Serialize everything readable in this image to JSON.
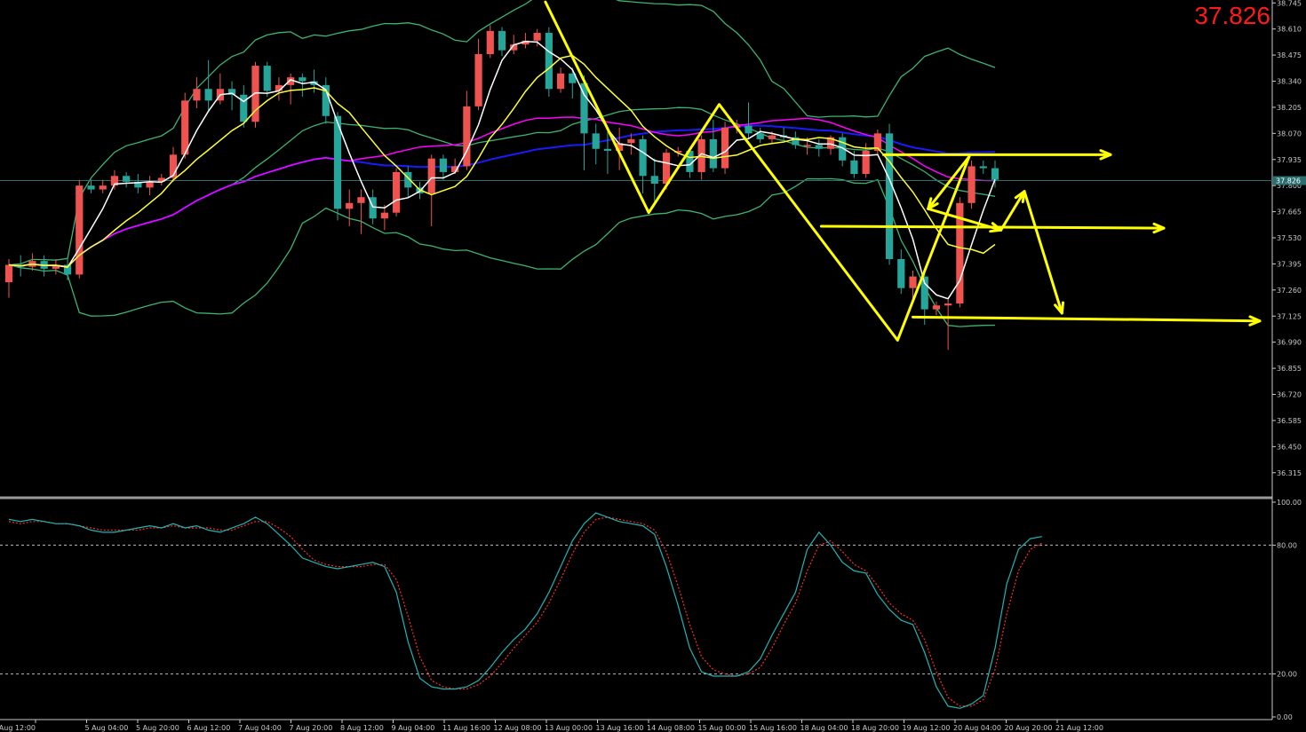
{
  "price_label": "37.826",
  "colors": {
    "background": "#000000",
    "bull": "#26a69a",
    "bear": "#ef5350",
    "bollinger": "#3cb371",
    "ma_fast": "#ffffff",
    "ma_mid": "#ffff33",
    "ma_slow_blue": "#1a1aff",
    "ma_magenta": "#ff00ff",
    "annotation": "#ffff00",
    "stoch_main": "#1fb5b5",
    "stoch_signal": "#ff2a2a",
    "price_line": "#2a6f6f"
  },
  "chart_data": [
    {
      "type": "candlestick",
      "price_axis": {
        "ticks": [
          "38.745",
          "38.610",
          "38.475",
          "38.340",
          "38.205",
          "38.070",
          "37.935",
          "37.800",
          "37.665",
          "37.530",
          "37.395",
          "37.260",
          "37.125",
          "36.990",
          "36.855",
          "36.720",
          "36.585",
          "36.450",
          "36.315"
        ],
        "ylim": [
          36.19,
          38.76
        ]
      },
      "time_axis": {
        "labels": [
          "4 Aug 12:00",
          "5 Aug 04:00",
          "5 Aug 20:00",
          "6 Aug 12:00",
          "7 Aug 04:00",
          "7 Aug 20:00",
          "8 Aug 12:00",
          "9 Aug 04:00",
          "11 Aug 16:00",
          "12 Aug 08:00",
          "13 Aug 00:00",
          "13 Aug 16:00",
          "14 Aug 08:00",
          "15 Aug 00:00",
          "15 Aug 16:00",
          "18 Aug 04:00",
          "18 Aug 20:00",
          "19 Aug 12:00",
          "20 Aug 04:00",
          "20 Aug 20:00",
          "21 Aug 12:00"
        ]
      },
      "current_price": 37.826,
      "candles": [
        [
          37.3,
          37.39,
          37.42,
          37.22
        ],
        [
          37.39,
          37.38,
          37.44,
          37.33
        ],
        [
          37.38,
          37.41,
          37.45,
          37.36
        ],
        [
          37.41,
          37.37,
          37.44,
          37.33
        ],
        [
          37.37,
          37.39,
          37.42,
          37.34
        ],
        [
          37.39,
          37.34,
          37.43,
          37.31
        ],
        [
          37.34,
          37.8,
          37.83,
          37.32
        ],
        [
          37.8,
          37.78,
          37.83,
          37.76
        ],
        [
          37.78,
          37.8,
          37.83,
          37.76
        ],
        [
          37.8,
          37.85,
          37.88,
          37.78
        ],
        [
          37.85,
          37.82,
          37.87,
          37.79
        ],
        [
          37.82,
          37.79,
          37.86,
          37.76
        ],
        [
          37.79,
          37.82,
          37.85,
          37.75
        ],
        [
          37.82,
          37.84,
          37.86,
          37.8
        ],
        [
          37.84,
          37.96,
          38.0,
          37.82
        ],
        [
          37.96,
          38.24,
          38.28,
          37.94
        ],
        [
          38.24,
          38.3,
          38.36,
          38.2
        ],
        [
          38.3,
          38.24,
          38.45,
          38.18
        ],
        [
          38.24,
          38.3,
          38.38,
          38.22
        ],
        [
          38.3,
          38.27,
          38.34,
          38.19
        ],
        [
          38.27,
          38.13,
          38.32,
          38.1
        ],
        [
          38.13,
          38.42,
          38.44,
          38.1
        ],
        [
          38.42,
          38.29,
          38.44,
          38.26
        ],
        [
          38.29,
          38.32,
          38.36,
          38.24
        ],
        [
          38.32,
          38.36,
          38.38,
          38.22
        ],
        [
          38.36,
          38.34,
          38.38,
          38.26
        ],
        [
          38.34,
          38.32,
          38.4,
          38.28
        ],
        [
          38.32,
          38.16,
          38.36,
          38.12
        ],
        [
          38.16,
          37.68,
          38.18,
          37.62
        ],
        [
          37.68,
          37.71,
          37.78,
          37.59
        ],
        [
          37.71,
          37.74,
          37.78,
          37.55
        ],
        [
          37.74,
          37.63,
          37.78,
          37.6
        ],
        [
          37.63,
          37.66,
          37.7,
          37.57
        ],
        [
          37.66,
          37.87,
          37.89,
          37.64
        ],
        [
          37.87,
          37.79,
          37.9,
          37.74
        ],
        [
          37.79,
          37.76,
          37.82,
          37.73
        ],
        [
          37.76,
          37.94,
          37.96,
          37.59
        ],
        [
          37.94,
          37.87,
          37.96,
          37.83
        ],
        [
          37.87,
          37.9,
          37.94,
          37.86
        ],
        [
          37.9,
          38.21,
          38.29,
          37.88
        ],
        [
          38.21,
          38.48,
          38.56,
          38.19
        ],
        [
          38.48,
          38.6,
          38.63,
          38.46
        ],
        [
          38.6,
          38.5,
          38.62,
          38.47
        ],
        [
          38.5,
          38.53,
          38.58,
          38.48
        ],
        [
          38.53,
          38.55,
          38.59,
          38.51
        ],
        [
          38.55,
          38.59,
          38.61,
          38.52
        ],
        [
          38.59,
          38.3,
          38.62,
          38.26
        ],
        [
          38.3,
          38.38,
          38.41,
          38.28
        ],
        [
          38.38,
          38.33,
          38.41,
          38.25
        ],
        [
          38.33,
          38.07,
          38.37,
          37.88
        ],
        [
          38.07,
          37.99,
          38.12,
          37.91
        ],
        [
          37.99,
          37.98,
          38.08,
          37.86
        ],
        [
          37.98,
          38.02,
          38.1,
          37.88
        ],
        [
          38.02,
          38.04,
          38.07,
          37.96
        ],
        [
          38.04,
          37.85,
          38.06,
          37.76
        ],
        [
          37.85,
          37.81,
          37.94,
          37.7
        ],
        [
          37.81,
          37.97,
          37.99,
          37.78
        ],
        [
          37.97,
          37.98,
          38.0,
          37.95
        ],
        [
          37.98,
          37.87,
          38.0,
          37.84
        ],
        [
          37.87,
          38.04,
          38.06,
          37.83
        ],
        [
          38.04,
          37.89,
          38.14,
          37.87
        ],
        [
          37.89,
          38.1,
          38.13,
          37.86
        ],
        [
          38.1,
          38.11,
          38.14,
          38.07
        ],
        [
          38.11,
          38.07,
          38.23,
          38.04
        ],
        [
          38.07,
          38.04,
          38.1,
          38.02
        ],
        [
          38.04,
          38.06,
          38.08,
          38.02
        ],
        [
          38.06,
          38.05,
          38.1,
          38.03
        ],
        [
          38.05,
          38.01,
          38.08,
          37.99
        ],
        [
          38.01,
          38.01,
          38.05,
          37.96
        ],
        [
          38.01,
          37.99,
          38.04,
          37.95
        ],
        [
          37.99,
          38.05,
          38.06,
          37.96
        ],
        [
          38.05,
          37.93,
          38.07,
          37.9
        ],
        [
          37.93,
          37.86,
          37.98,
          37.84
        ],
        [
          37.86,
          37.98,
          38.02,
          37.84
        ],
        [
          37.98,
          38.07,
          38.09,
          37.96
        ],
        [
          38.07,
          37.42,
          38.12,
          37.39
        ],
        [
          37.42,
          37.27,
          37.47,
          37.24
        ],
        [
          37.27,
          37.33,
          37.36,
          37.2
        ],
        [
          37.33,
          37.16,
          37.36,
          37.08
        ],
        [
          37.16,
          37.18,
          37.2,
          37.13
        ],
        [
          37.18,
          37.19,
          37.21,
          36.95
        ],
        [
          37.19,
          37.71,
          37.74,
          37.17
        ],
        [
          37.71,
          37.9,
          37.93,
          37.68
        ],
        [
          37.9,
          37.89,
          37.93,
          37.86
        ],
        [
          37.89,
          37.83,
          37.93,
          37.79
        ]
      ]
    },
    {
      "type": "line",
      "indicator": "stochastic",
      "ylim": [
        0,
        100
      ],
      "ticks": [
        "100.00",
        "80.00",
        "20.00",
        "0.00"
      ],
      "levels": [
        80,
        20
      ],
      "series": [
        {
          "values": [
            92,
            91,
            92,
            91,
            90,
            90,
            89,
            87,
            86,
            86,
            87,
            88,
            89,
            88,
            90,
            88,
            89,
            87,
            86,
            88,
            90,
            93,
            90,
            85,
            80,
            74,
            72,
            70,
            69,
            70,
            71,
            72,
            70,
            58,
            35,
            18,
            14,
            13,
            13,
            14,
            17,
            23,
            30,
            36,
            41,
            48,
            58,
            70,
            82,
            90,
            95,
            93,
            91,
            90,
            89,
            85,
            70,
            52,
            32,
            21,
            19,
            19,
            19,
            21,
            27,
            38,
            48,
            58,
            78,
            86,
            80,
            72,
            68,
            67,
            57,
            50,
            45,
            43,
            30,
            14,
            5,
            4,
            6,
            10,
            32,
            62,
            78,
            83,
            84
          ]
        },
        {
          "values": [
            91,
            90,
            91,
            91,
            90,
            90,
            89,
            88,
            87,
            87,
            87,
            87,
            88,
            88,
            89,
            88,
            88,
            88,
            87,
            87,
            89,
            91,
            91,
            88,
            84,
            78,
            73,
            71,
            70,
            70,
            70,
            71,
            71,
            64,
            47,
            28,
            17,
            14,
            13,
            13,
            15,
            19,
            25,
            32,
            38,
            44,
            53,
            64,
            76,
            86,
            92,
            93,
            92,
            91,
            90,
            87,
            77,
            61,
            43,
            28,
            22,
            20,
            19,
            20,
            23,
            32,
            43,
            53,
            68,
            80,
            82,
            77,
            71,
            68,
            61,
            53,
            48,
            45,
            36,
            21,
            9,
            5,
            5,
            8,
            22,
            48,
            68,
            78,
            81
          ]
        }
      ]
    }
  ]
}
